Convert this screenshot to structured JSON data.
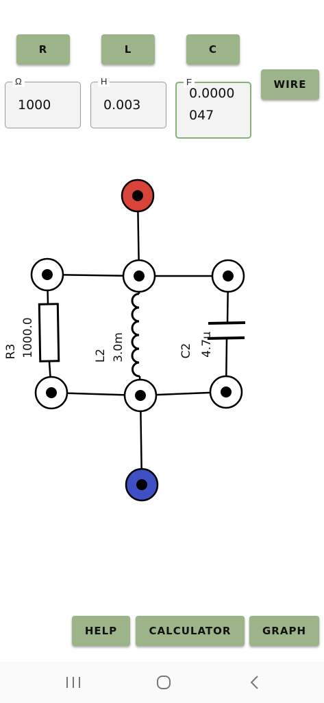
{
  "components": {
    "r_label": "R",
    "l_label": "L",
    "c_label": "C",
    "wire_label": "WIRE"
  },
  "fields": {
    "resistance": {
      "unit": "Ω",
      "value": "1000"
    },
    "inductance": {
      "unit": "H",
      "value": "0.003"
    },
    "capacitance": {
      "unit": "F",
      "value_line1": "0.0000",
      "value_line2": "047"
    }
  },
  "circuit": {
    "resistor": {
      "name": "R3",
      "value": "1000.0"
    },
    "inductor": {
      "name": "L2",
      "value": "3.0m"
    },
    "capacitor": {
      "name": "C2",
      "value": "4.7μ"
    },
    "terminal_top_color": "#d9443a",
    "terminal_bottom_color": "#3f4fc4"
  },
  "footer": {
    "help_label": "HELP",
    "calculator_label": "CALCULATOR",
    "graph_label": "GRAPH"
  },
  "navbar": {
    "recents_icon": "recents-icon",
    "home_icon": "home-icon",
    "back_icon": "back-icon"
  }
}
